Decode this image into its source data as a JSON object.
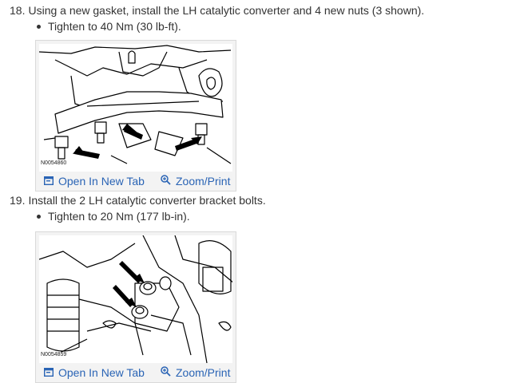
{
  "steps": [
    {
      "number": "18.",
      "text": "Using a new gasket, install the LH catalytic converter and 4 new nuts (3 shown).",
      "bullet": "Tighten to 40 Nm (30 lb-ft).",
      "figure": {
        "caption": "N0054860",
        "open_label": "Open In New Tab",
        "zoom_label": "Zoom/Print"
      }
    },
    {
      "number": "19.",
      "text": "Install the 2 LH catalytic converter bracket bolts.",
      "bullet": "Tighten to 20 Nm (177 lb-in).",
      "figure": {
        "caption": "N0054859",
        "open_label": "Open In New Tab",
        "zoom_label": "Zoom/Print"
      }
    }
  ],
  "colors": {
    "link": "#2a64b5",
    "text": "#333333",
    "frame": "#d9d9d9"
  },
  "icons": {
    "open": "open-in-new-tab-icon",
    "zoom": "zoom-icon"
  }
}
